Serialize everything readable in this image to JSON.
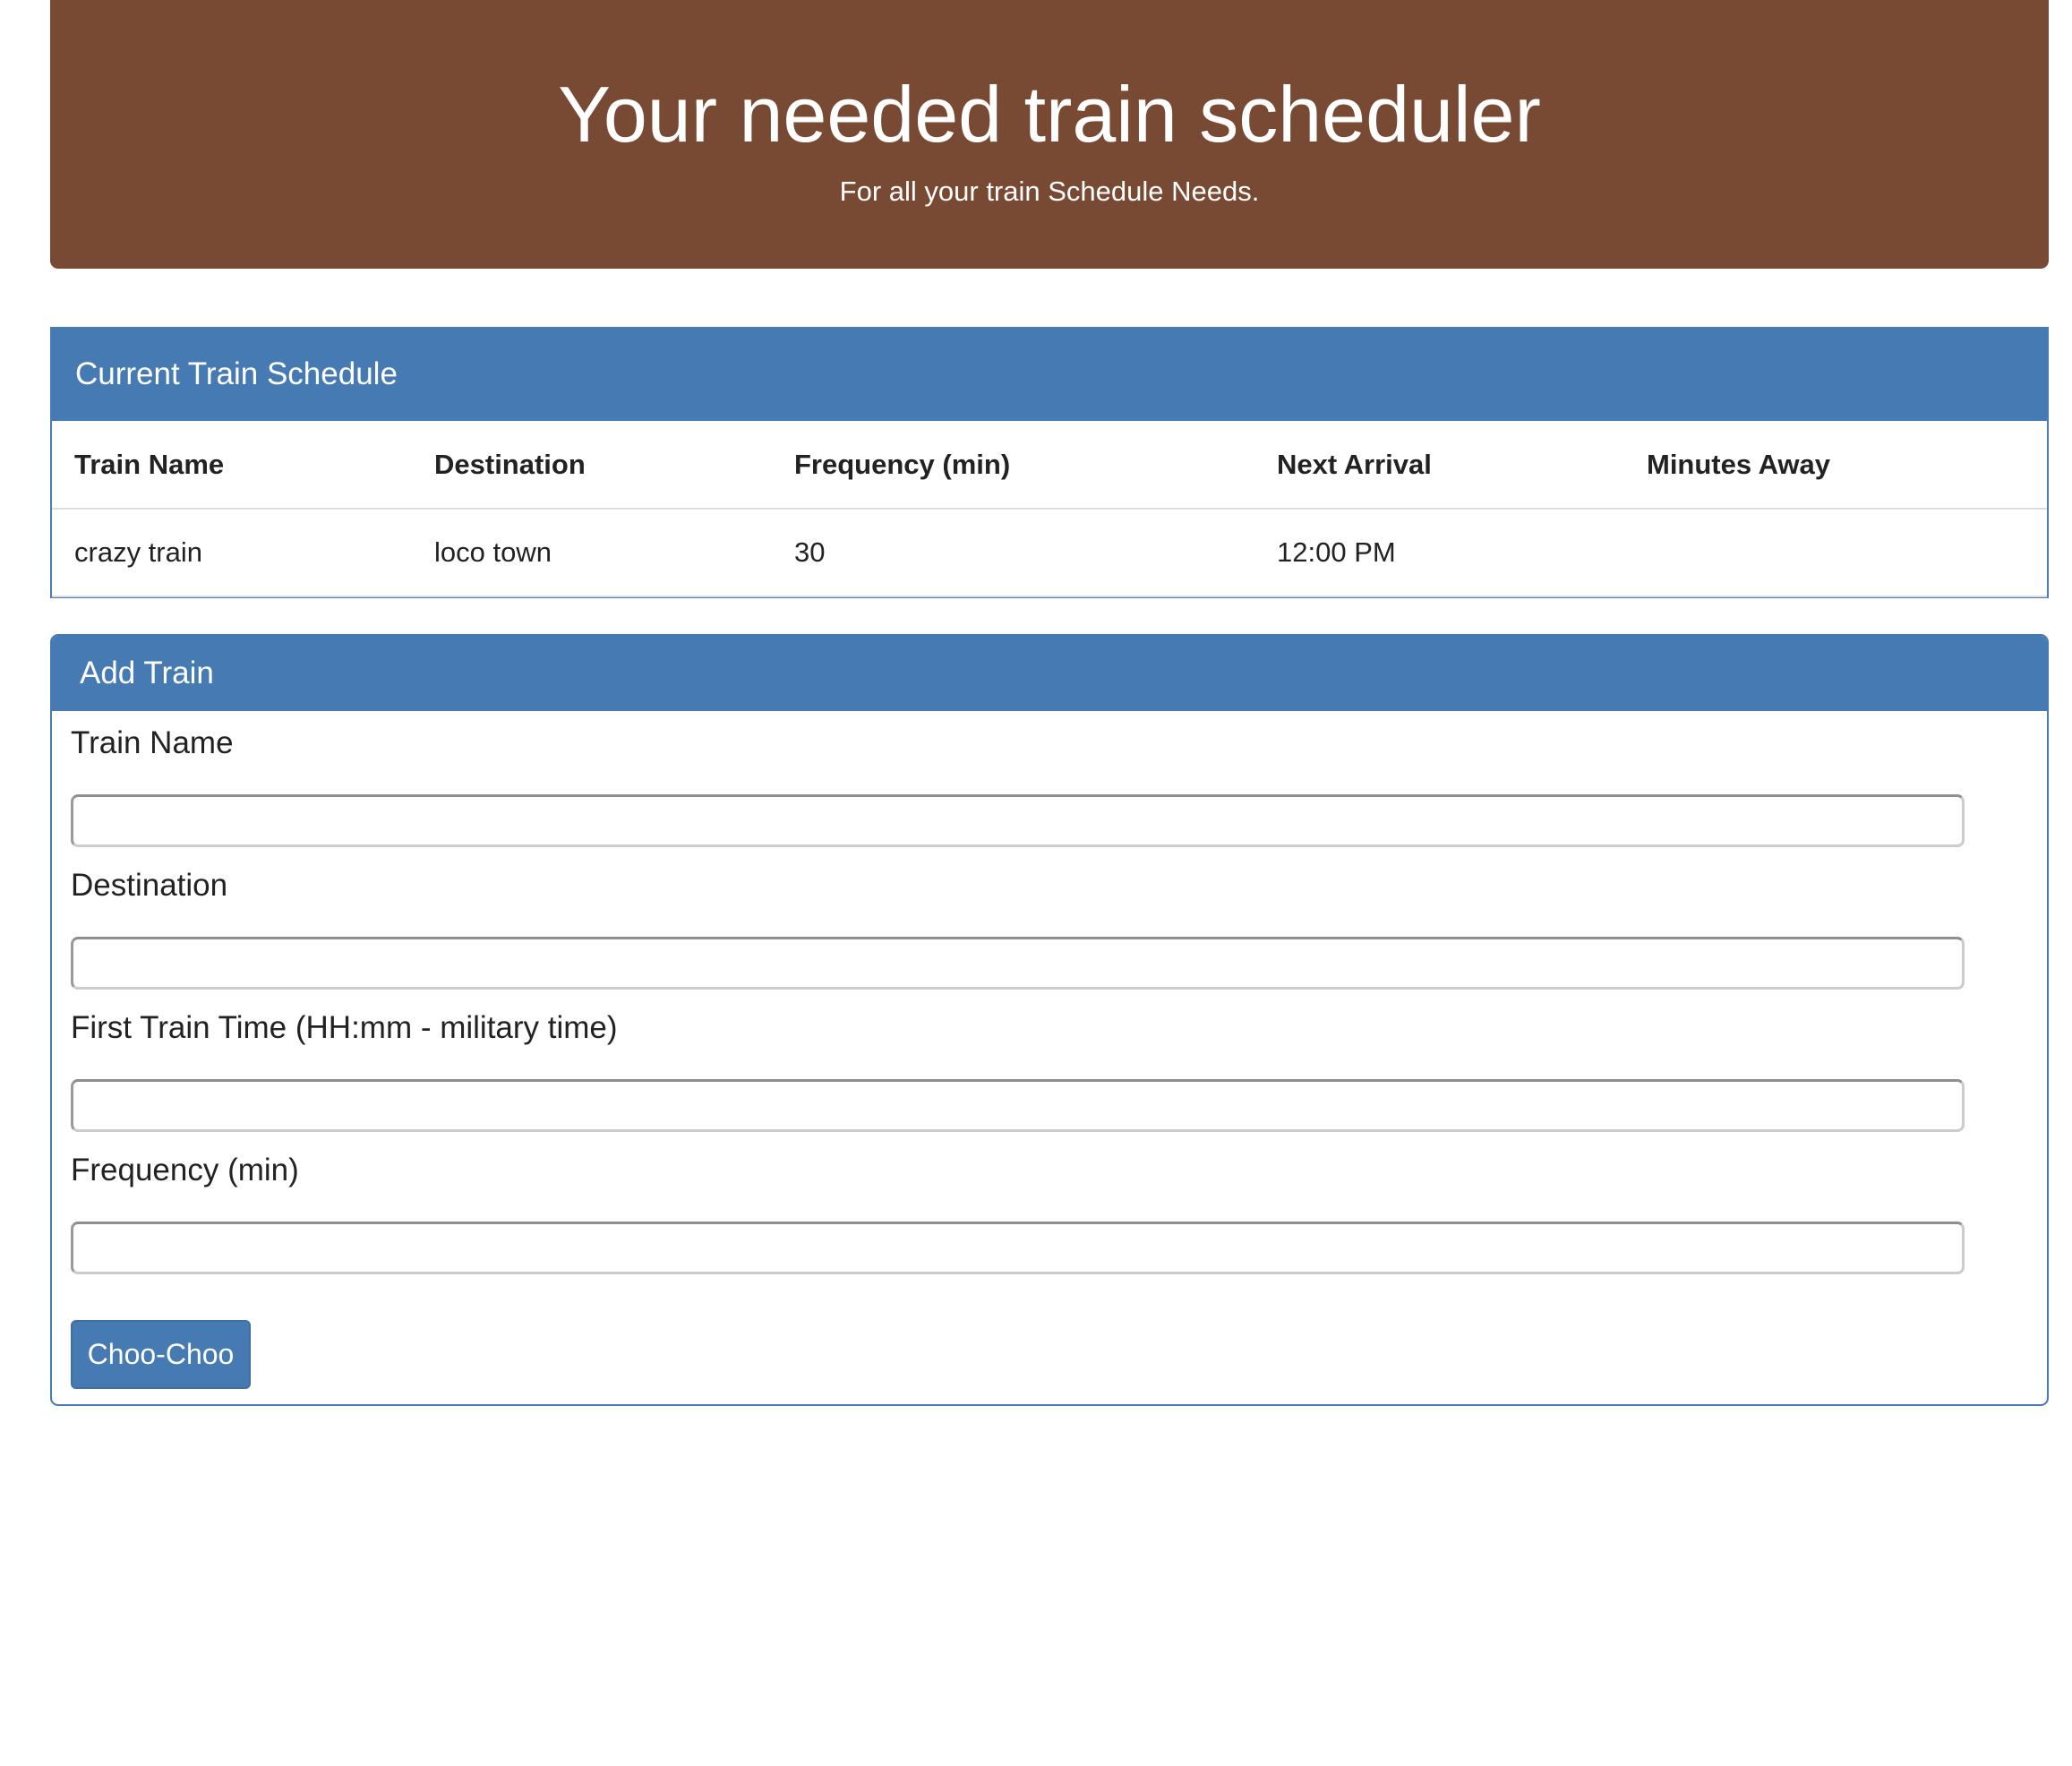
{
  "header": {
    "title": "Your needed train scheduler",
    "subtitle": "For all your train Schedule Needs."
  },
  "schedule": {
    "title": "Current Train Schedule",
    "columns": [
      "Train Name",
      "Destination",
      "Frequency (min)",
      "Next Arrival",
      "Minutes Away"
    ],
    "rows": [
      [
        "crazy train",
        "loco town",
        "30",
        "12:00 PM",
        ""
      ]
    ]
  },
  "add_train": {
    "title": "Add Train",
    "fields": [
      {
        "label": "Train Name",
        "value": ""
      },
      {
        "label": "Destination",
        "value": ""
      },
      {
        "label": "First Train Time (HH:mm - military time)",
        "value": ""
      },
      {
        "label": "Frequency (min)",
        "value": ""
      }
    ],
    "submit_label": "Choo-Choo"
  },
  "colors": {
    "header_bg": "#794a33",
    "accent": "#467ab3"
  }
}
